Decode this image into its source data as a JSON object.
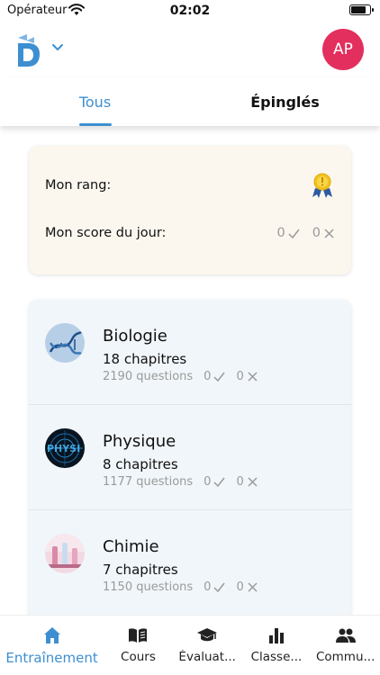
{
  "status_bar": {
    "carrier": "Opérateur",
    "time": "02:02",
    "battery_level": 0.85
  },
  "header": {
    "avatar_initials": "AP"
  },
  "tabs": [
    {
      "label": "Tous",
      "active": true
    },
    {
      "label": "Épinglés",
      "active": false
    }
  ],
  "score_card": {
    "rank_label": "Mon rang:",
    "score_label": "Mon score du jour:",
    "correct": "0",
    "wrong": "0"
  },
  "subjects": [
    {
      "name": "Biologie",
      "chapters": "18 chapitres",
      "questions": "2190 questions",
      "correct": "0",
      "wrong": "0"
    },
    {
      "name": "Physique",
      "chapters": "8 chapitres",
      "questions": "1177 questions",
      "correct": "0",
      "wrong": "0"
    },
    {
      "name": "Chimie",
      "chapters": "7 chapitres",
      "questions": "1150 questions",
      "correct": "0",
      "wrong": "0"
    }
  ],
  "bottom_nav": [
    {
      "label": "Entraînement",
      "icon": "home-icon",
      "active": true
    },
    {
      "label": "Cours",
      "icon": "book-icon",
      "active": false
    },
    {
      "label": "Évaluat...",
      "icon": "graduation-cap-icon",
      "active": false
    },
    {
      "label": "Classe...",
      "icon": "bar-chart-icon",
      "active": false
    },
    {
      "label": "Commu...",
      "icon": "people-icon",
      "active": false
    }
  ],
  "colors": {
    "accent": "#3d8fd1",
    "avatar": "#e32f5e",
    "score_card_bg": "#fbf7ef",
    "list_bg": "#f1f6fa"
  }
}
